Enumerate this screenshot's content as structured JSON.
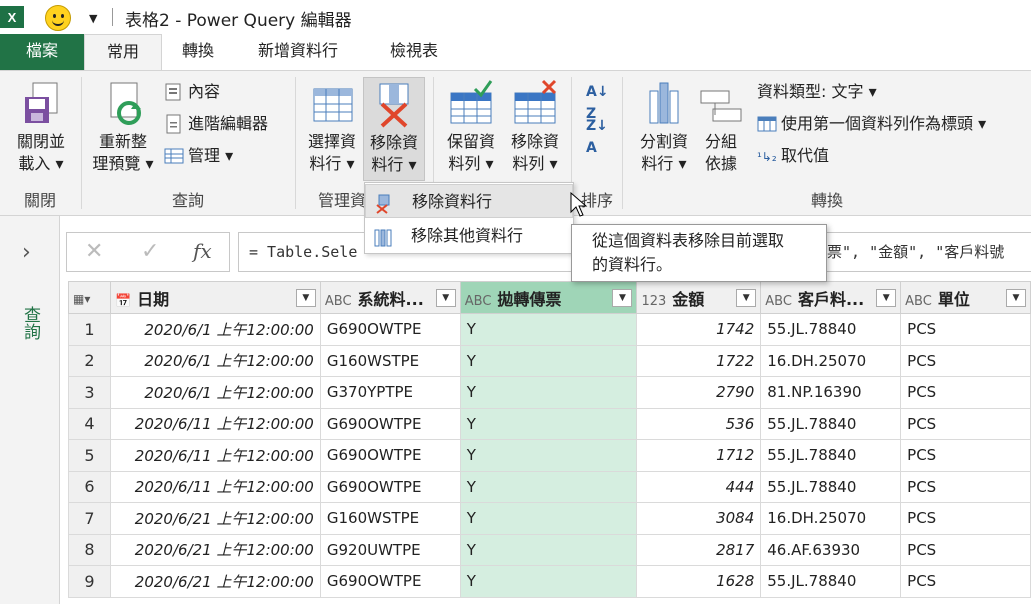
{
  "window": {
    "title": "表格2 - Power Query 編輯器"
  },
  "tabs": {
    "file": "檔案",
    "home": "常用",
    "transform": "轉換",
    "add_column": "新增資料行",
    "view": "檢視表"
  },
  "ribbon": {
    "close": {
      "btn1": "關閉並",
      "btn2": "載入",
      "label": "關閉"
    },
    "query": {
      "refresh1": "重新整",
      "refresh2": "理預覽",
      "properties": "內容",
      "advanced": "進階編輯器",
      "manage": "管理",
      "label": "查詢"
    },
    "manage_columns": {
      "choose1": "選擇資",
      "choose2": "料行",
      "remove1": "移除資",
      "remove2": "料行",
      "label": "管理資"
    },
    "reduce_rows": {
      "keep1": "保留資",
      "keep2": "料列",
      "remove1": "移除資",
      "remove2": "料列"
    },
    "sort": {
      "label": "排序"
    },
    "transform": {
      "split1": "分割資",
      "split2": "料行",
      "group1": "分組",
      "group2": "依據",
      "data_type": "資料類型: 文字",
      "first_row": "使用第一個資料列作為標頭",
      "replace": "取代值",
      "label": "轉換"
    }
  },
  "menu": {
    "items": [
      "移除資料行",
      "移除其他資料行"
    ]
  },
  "tooltip": {
    "line1": "從這個資料表移除目前選取",
    "line2": "的資料行。"
  },
  "leftnav": {
    "label": "查詢"
  },
  "formula": {
    "text": "= Table.Sele",
    "tail": "票\", \"金額\", \"客戶料號"
  },
  "table": {
    "columns": [
      {
        "type": "📅",
        "name": "日期"
      },
      {
        "type": "ABC",
        "name": "系統料..."
      },
      {
        "type": "ABC",
        "name": "拋轉傳票"
      },
      {
        "type": "123",
        "name": "金額"
      },
      {
        "type": "ABC",
        "name": "客戶料..."
      },
      {
        "type": "ABC",
        "name": "單位"
      }
    ],
    "rows": [
      [
        "1",
        "2020/6/1 上午12:00:00",
        "G690OWTPE",
        "Y",
        "1742",
        "55.JL.78840",
        "PCS"
      ],
      [
        "2",
        "2020/6/1 上午12:00:00",
        "G160WSTPE",
        "Y",
        "1722",
        "16.DH.25070",
        "PCS"
      ],
      [
        "3",
        "2020/6/1 上午12:00:00",
        "G370YPTPE",
        "Y",
        "2790",
        "81.NP.16390",
        "PCS"
      ],
      [
        "4",
        "2020/6/11 上午12:00:00",
        "G690OWTPE",
        "Y",
        "536",
        "55.JL.78840",
        "PCS"
      ],
      [
        "5",
        "2020/6/11 上午12:00:00",
        "G690OWTPE",
        "Y",
        "1712",
        "55.JL.78840",
        "PCS"
      ],
      [
        "6",
        "2020/6/11 上午12:00:00",
        "G690OWTPE",
        "Y",
        "444",
        "55.JL.78840",
        "PCS"
      ],
      [
        "7",
        "2020/6/21 上午12:00:00",
        "G160WSTPE",
        "Y",
        "3084",
        "16.DH.25070",
        "PCS"
      ],
      [
        "8",
        "2020/6/21 上午12:00:00",
        "G920UWTPE",
        "Y",
        "2817",
        "46.AF.63930",
        "PCS"
      ],
      [
        "9",
        "2020/6/21 上午12:00:00",
        "G690OWTPE",
        "Y",
        "1628",
        "55.JL.78840",
        "PCS"
      ]
    ]
  }
}
